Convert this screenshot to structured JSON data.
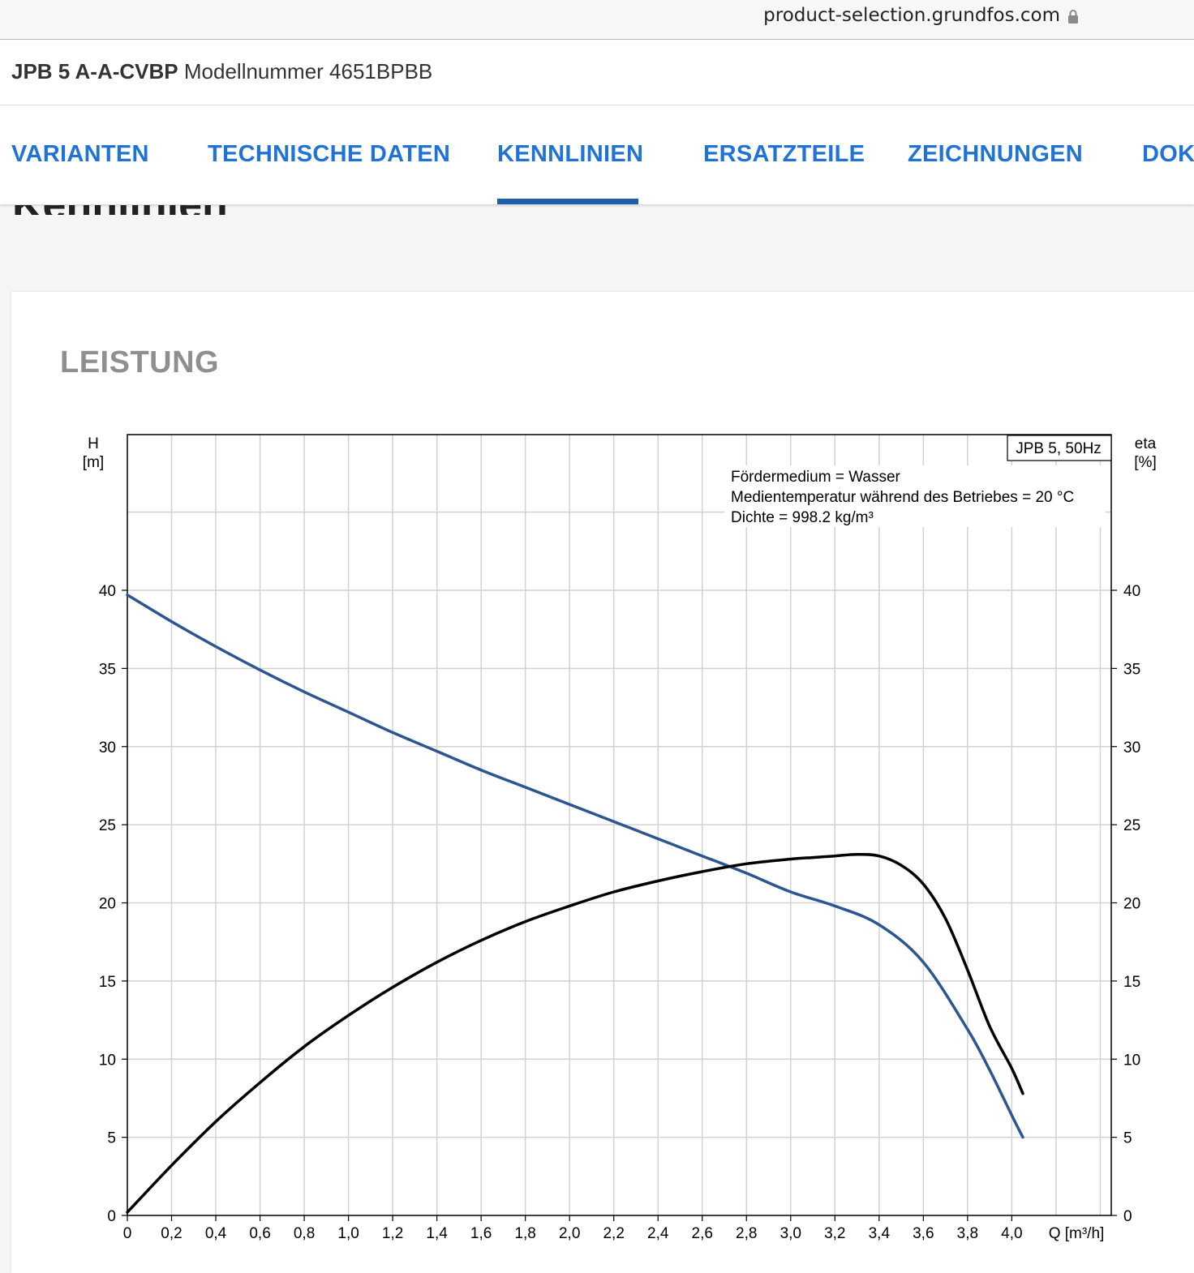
{
  "browser": {
    "url": "product-selection.grundfos.com"
  },
  "product": {
    "name": "JPB 5 A-A-CVBP",
    "model": "Modellnummer 4651BPBB"
  },
  "tabs": [
    {
      "label": "VARIANTEN"
    },
    {
      "label": "TECHNISCHE DATEN"
    },
    {
      "label": "KENNLINIEN",
      "active": true
    },
    {
      "label": "ERSATZTEILE"
    },
    {
      "label": "ZEICHNUNGEN"
    },
    {
      "label": "DOK"
    }
  ],
  "page_heading": "Kennlinien",
  "section": {
    "title": "LEISTUNG"
  },
  "colors": {
    "accent": "#1f73d8",
    "head_curve": "#2b5691",
    "eta_curve": "#000000"
  },
  "chart_data": {
    "type": "line",
    "title": "JPB 5, 50Hz",
    "annotations": [
      "Fördermedium = Wasser",
      "Medientemperatur während des Betriebes = 20 °C",
      "Dichte = 998.2 kg/m³"
    ],
    "xlabel": "Q [m³/h]",
    "ylabel_left": [
      "H",
      "[m]"
    ],
    "ylabel_right": [
      "eta",
      "[%]"
    ],
    "xlim": [
      0,
      4.2
    ],
    "ylim": [
      0,
      50
    ],
    "x_ticks": [
      "0",
      "0,2",
      "0,4",
      "0,6",
      "0,8",
      "1,0",
      "1,2",
      "1,4",
      "1,6",
      "1,8",
      "2,0",
      "2,2",
      "2,4",
      "2,6",
      "2,8",
      "3,0",
      "3,2",
      "3,4",
      "3,6",
      "3,8",
      "4,0"
    ],
    "y_ticks": [
      "0",
      "5",
      "10",
      "15",
      "20",
      "25",
      "30",
      "35",
      "40"
    ],
    "grid": true,
    "series": [
      {
        "axis": "left",
        "x": [
          0,
          0.2,
          0.4,
          0.6,
          0.8,
          1.0,
          1.2,
          1.4,
          1.6,
          1.8,
          2.0,
          2.2,
          2.4,
          2.6,
          2.8,
          3.0,
          3.2,
          3.4,
          3.6,
          3.8,
          3.9,
          4.0,
          4.05
        ],
        "values": [
          39.7,
          38.0,
          36.4,
          34.9,
          33.5,
          32.2,
          30.9,
          29.7,
          28.5,
          27.4,
          26.3,
          25.2,
          24.1,
          23.0,
          21.9,
          20.7,
          19.8,
          18.6,
          16.2,
          11.9,
          9.3,
          6.4,
          5.0
        ]
      },
      {
        "axis": "right",
        "x": [
          0,
          0.2,
          0.4,
          0.6,
          0.8,
          1.0,
          1.2,
          1.4,
          1.6,
          1.8,
          2.0,
          2.2,
          2.4,
          2.6,
          2.8,
          3.0,
          3.1,
          3.2,
          3.3,
          3.4,
          3.5,
          3.6,
          3.7,
          3.8,
          3.9,
          4.0,
          4.05
        ],
        "values": [
          0.2,
          3.2,
          6.0,
          8.5,
          10.8,
          12.8,
          14.6,
          16.2,
          17.6,
          18.8,
          19.8,
          20.7,
          21.4,
          22.0,
          22.5,
          22.8,
          22.9,
          23.0,
          23.1,
          23.0,
          22.4,
          21.2,
          19.0,
          15.7,
          12.1,
          9.4,
          7.8
        ]
      }
    ]
  }
}
